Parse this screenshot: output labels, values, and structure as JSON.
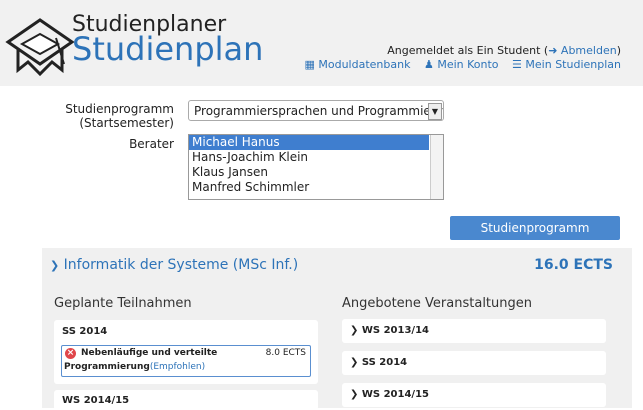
{
  "header": {
    "brand_top": "Studienplaner",
    "brand_main": "Studienplan",
    "login_text": "Angemeldet als Ein Student (",
    "logout_label": "Abmelden",
    "login_close": ")",
    "nav": [
      {
        "label": "Moduldatenbank",
        "icon": "database-icon"
      },
      {
        "label": "Mein Konto",
        "icon": "user-icon"
      },
      {
        "label": "Mein Studienplan",
        "icon": "list-icon"
      }
    ]
  },
  "form": {
    "program_label_1": "Studienprogramm",
    "program_label_2": "(Startsemester)",
    "program_value": "Programmiersprachen und Programmiersysteme",
    "advisor_label": "Berater",
    "advisors": [
      "Michael Hanus",
      "Hans-Joachim Klein",
      "Klaus Jansen",
      "Manfred Schimmler"
    ],
    "selected_advisor_index": 0,
    "save_label": "Studienprogramm speichern"
  },
  "panel": {
    "title": "Informatik der Systeme (MSc Inf.)",
    "ects": "16.0 ECTS",
    "planned_heading": "Geplante Teilnahmen",
    "offered_heading": "Angebotene Veranstaltungen",
    "planned_semesters": [
      "SS 2014",
      "WS 2014/15"
    ],
    "course": {
      "name_line1": "Nebenläufige und verteilte",
      "name_line2": "Programmierung",
      "recommended": "(Empfohlen)",
      "ects": "8.0 ECTS"
    },
    "offered_semesters": [
      "WS 2013/14",
      "SS 2014",
      "WS 2014/15"
    ]
  },
  "colors": {
    "accent": "#2d73b8",
    "button": "#4a88cf",
    "error": "#e0464a"
  }
}
